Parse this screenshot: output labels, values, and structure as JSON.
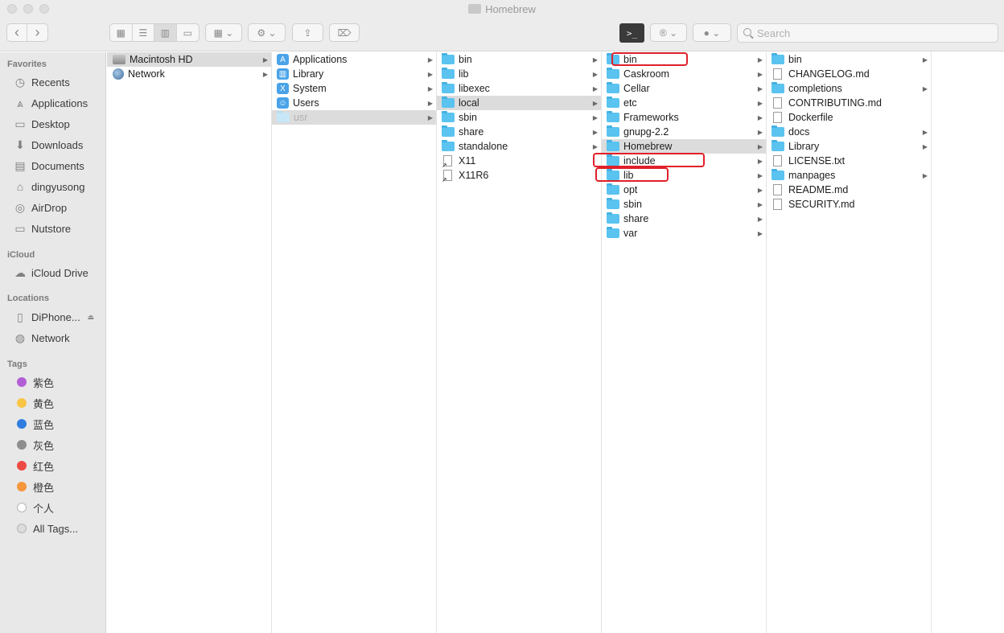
{
  "window": {
    "title": "Homebrew"
  },
  "toolbar": {
    "back": "‹",
    "forward": "›",
    "view_icons": "icon-view",
    "view_list": "list-view",
    "view_columns": "column-view",
    "view_gallery": "gallery-view",
    "group": "group-icon",
    "action": "⚙",
    "share": "⇪",
    "tag": "tag-icon",
    "terminal": ">_",
    "registered": "®",
    "search_placeholder": "Search"
  },
  "sidebar": {
    "favorites_header": "Favorites",
    "favorites": [
      "Recents",
      "Applications",
      "Desktop",
      "Downloads",
      "Documents",
      "dingyusong",
      "AirDrop",
      "Nutstore"
    ],
    "icloud_header": "iCloud",
    "icloud": [
      "iCloud Drive"
    ],
    "locations_header": "Locations",
    "locations": [
      "DiPhone...",
      "Network"
    ],
    "tags_header": "Tags",
    "tags": [
      {
        "label": "紫色",
        "color": "#b25fd6"
      },
      {
        "label": "黄色",
        "color": "#f8c545"
      },
      {
        "label": "蓝色",
        "color": "#2f7de1"
      },
      {
        "label": "灰色",
        "color": "#8e8e8e"
      },
      {
        "label": "红色",
        "color": "#ec4b43"
      },
      {
        "label": "橙色",
        "color": "#f5963b"
      },
      {
        "label": "个人",
        "color": "#ffffff"
      },
      {
        "label": "All Tags...",
        "color": "#dcdcdc"
      }
    ]
  },
  "columns": [
    {
      "items": [
        "Macintosh HD",
        "Network"
      ]
    },
    {
      "items": [
        "Applications",
        "Library",
        "System",
        "Users",
        "usr"
      ]
    },
    {
      "items": [
        "bin",
        "lib",
        "libexec",
        "local",
        "sbin",
        "share",
        "standalone",
        "X11",
        "X11R6"
      ]
    },
    {
      "items": [
        "bin",
        "Caskroom",
        "Cellar",
        "etc",
        "Frameworks",
        "gnupg-2.2",
        "Homebrew",
        "include",
        "lib",
        "opt",
        "sbin",
        "share",
        "var"
      ]
    },
    {
      "items": [
        "bin",
        "CHANGELOG.md",
        "completions",
        "CONTRIBUTING.md",
        "Dockerfile",
        "docs",
        "Library",
        "LICENSE.txt",
        "manpages",
        "README.md",
        "SECURITY.md"
      ]
    }
  ]
}
